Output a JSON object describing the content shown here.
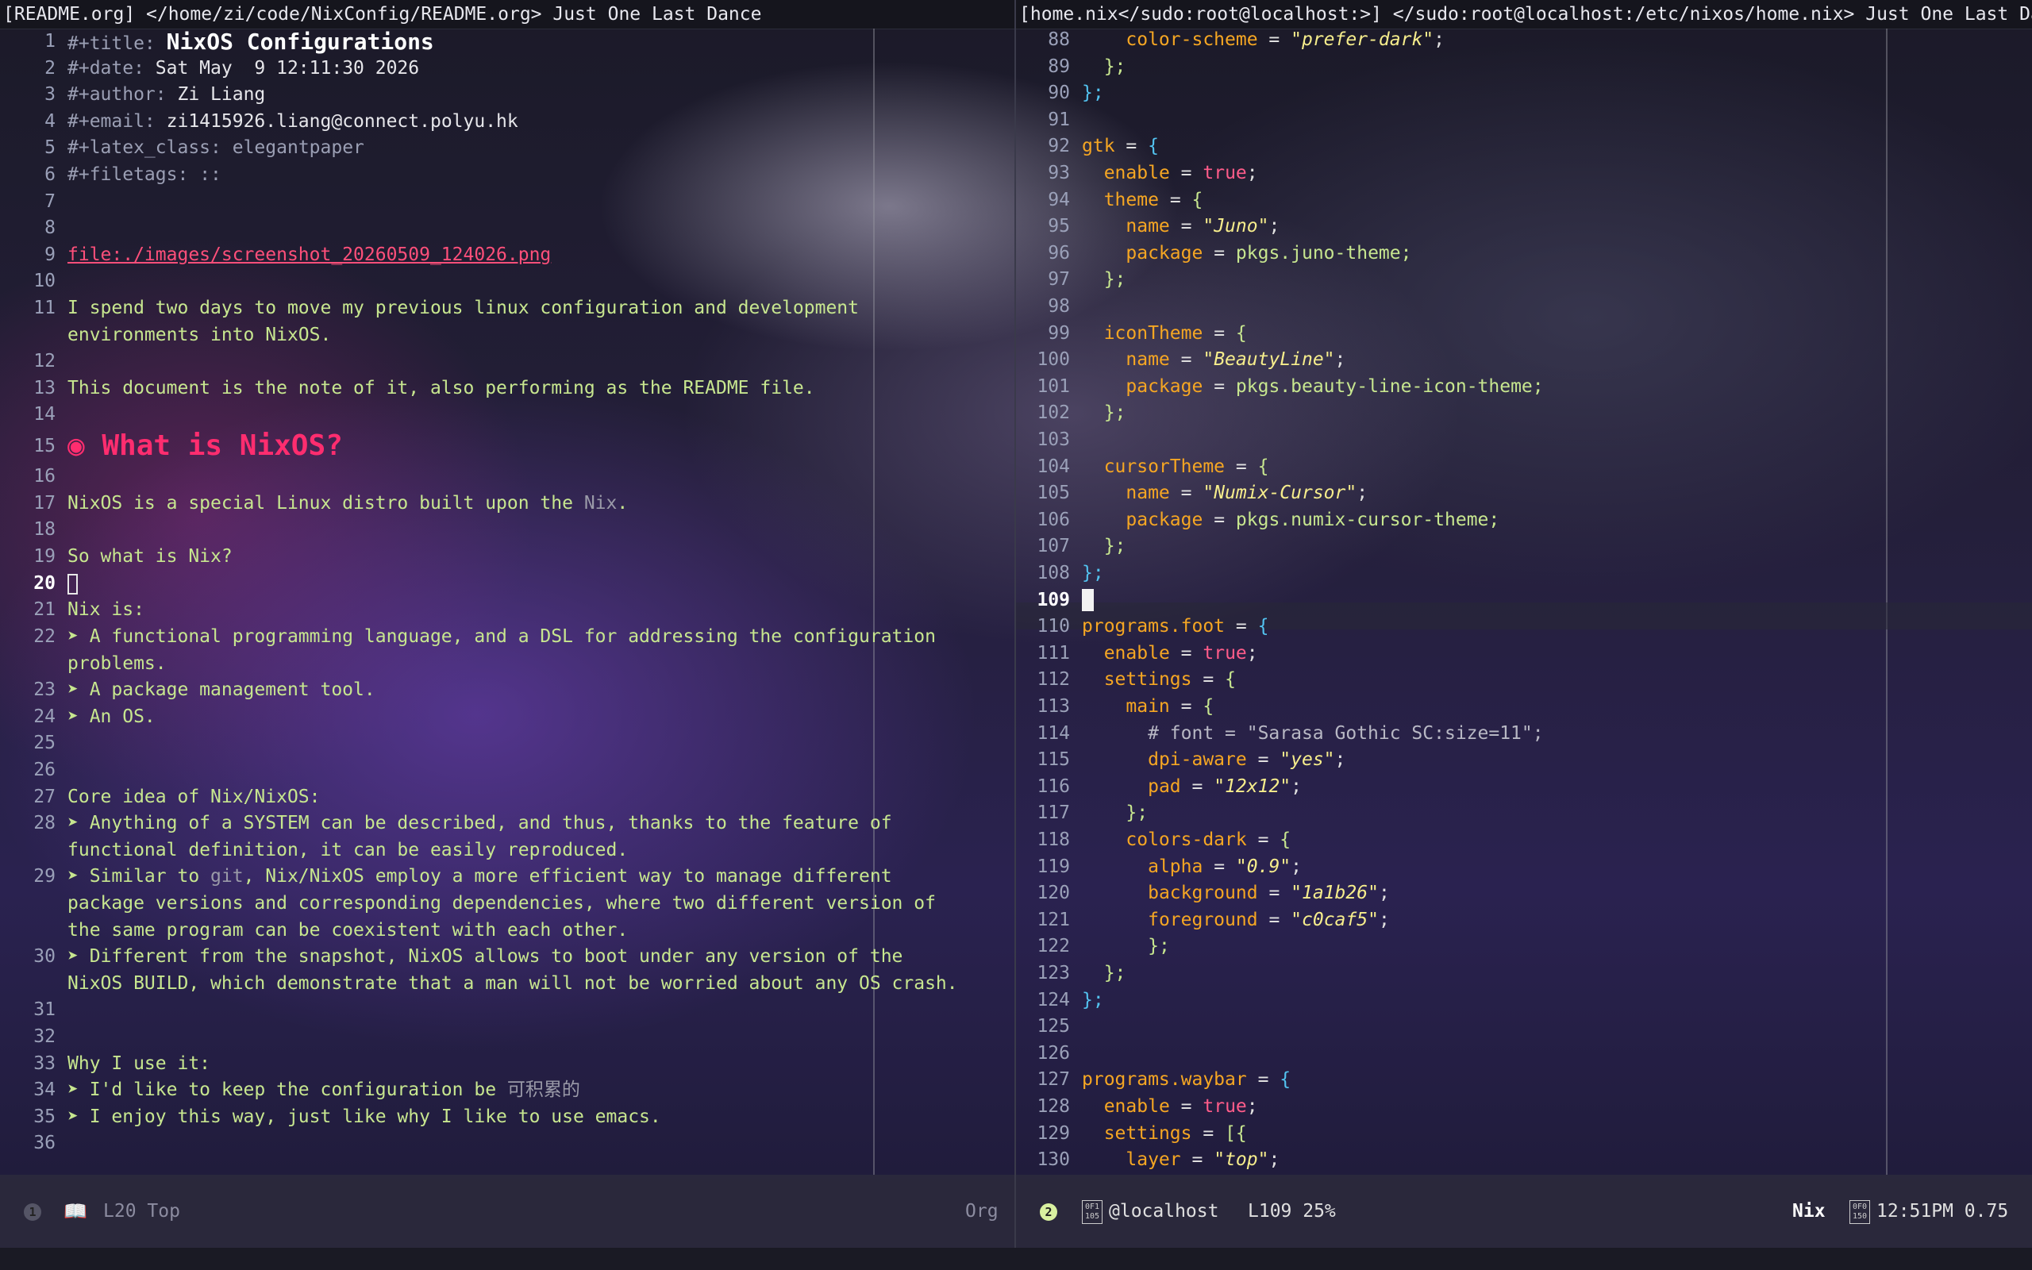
{
  "window": {
    "left_title": "[README.org] </home/zi/code/NixConfig/README.org> Just One Last Dance",
    "right_title": "[home.nix</sudo:root@localhost:>] </sudo:root@localhost:/etc/nixos/home.nix> Just One Last Dance"
  },
  "left_pane": {
    "filename": "README.org",
    "meta": {
      "title_key": "#+title:",
      "title_val": "NixOS Configurations",
      "date_key": "#+date:",
      "date_val": "Sat May  9 12:11:30 2026",
      "author_key": "#+author:",
      "author_val": "Zi Liang",
      "email_key": "#+email:",
      "email_val": "zi1415926.liang@connect.polyu.hk",
      "latex_key": "#+latex_class:",
      "latex_val": "elegantpaper",
      "filetags_key": "#+filetags:",
      "filetags_val": "::"
    },
    "link": "file:./images/screenshot_20260509_124026.png",
    "p11a": "I spend two days to move my previous linux configuration and development",
    "p11b": "environments into NixOS.",
    "p13": "This document is the note of it, also performing as the README file.",
    "h15_bullet": "◉",
    "h15": "What is NixOS?",
    "p17a": "NixOS is a special Linux distro built upon the ",
    "p17b": "Nix",
    "p17c": ".",
    "p19": "So what is Nix?",
    "p21": "Nix is:",
    "b22a": "➤ A functional programming language, and a DSL for addressing the configuration",
    "b22b": "problems.",
    "b23": "➤ A package management tool.",
    "b24": "➤ An OS.",
    "p27": "Core idea of Nix/NixOS:",
    "b28a": "➤ Anything of a SYSTEM can be described, and thus, thanks to the feature of",
    "b28b": "functional definition, it can be easily reproduced.",
    "b29a1": "➤ Similar to ",
    "b29a2": "git",
    "b29a3": ", Nix/NixOS employ a more efficient way to manage different",
    "b29b": "package versions and corresponding dependencies, where two different version of",
    "b29c": "the same program can be coexistent with each other.",
    "b30a": "➤ Different from the snapshot, NixOS allows to boot under any version of the",
    "b30b": "NixOS BUILD, which demonstrate that a man will not be worried about any OS crash.",
    "p33": "Why I use it:",
    "b34a": "➤ I'd like to keep the configuration be ",
    "b34b": "可积累的",
    "b35": "➤ I enjoy this way, just like why I like to use emacs.",
    "line_numbers": [
      "1",
      "2",
      "3",
      "4",
      "5",
      "6",
      "7",
      "8",
      "9",
      "10",
      "11",
      "12",
      "13",
      "14",
      "15",
      "16",
      "17",
      "18",
      "19",
      "20",
      "21",
      "22",
      "23",
      "24",
      "25",
      "26",
      "27",
      "28",
      "29",
      "30",
      "31",
      "32",
      "33",
      "34",
      "35",
      "36"
    ]
  },
  "right_pane": {
    "filename": "home.nix",
    "line_numbers": [
      "88",
      "89",
      "90",
      "91",
      "92",
      "93",
      "94",
      "95",
      "96",
      "97",
      "98",
      "99",
      "100",
      "101",
      "102",
      "103",
      "104",
      "105",
      "106",
      "107",
      "108",
      "109",
      "110",
      "111",
      "112",
      "113",
      "114",
      "115",
      "116",
      "117",
      "118",
      "119",
      "120",
      "121",
      "122",
      "123",
      "124",
      "125",
      "126",
      "127",
      "128",
      "129",
      "130"
    ],
    "code": {
      "l88k": "color-scheme",
      "l88v": "\"prefer-dark\"",
      "l89": "};",
      "l90": "};",
      "l92k": "gtk",
      "l92b": "{",
      "l93k": "enable",
      "l93v": "true",
      "l94k": "theme",
      "l94b": "{",
      "l95k": "name",
      "l95v": "\"Juno\"",
      "l96k": "package",
      "l96v": "pkgs.juno-theme;",
      "l97": "};",
      "l99k": "iconTheme",
      "l99b": "{",
      "l100k": "name",
      "l100v": "\"BeautyLine\"",
      "l101k": "package",
      "l101v": "pkgs.beauty-line-icon-theme;",
      "l102": "};",
      "l104k": "cursorTheme",
      "l104b": "{",
      "l105k": "name",
      "l105v": "\"Numix-Cursor\"",
      "l106k": "package",
      "l106v": "pkgs.numix-cursor-theme;",
      "l107": "};",
      "l108": "};",
      "l110k": "programs.foot",
      "l110b": "{",
      "l111k": "enable",
      "l111v": "true",
      "l112k": "settings",
      "l112b": "{",
      "l113k": "main",
      "l113b": "{",
      "l114": "# font = \"Sarasa Gothic SC:size=11\";",
      "l115k": "dpi-aware",
      "l115v": "\"yes\"",
      "l116k": "pad",
      "l116v": "\"12x12\"",
      "l117": "};",
      "l118k": "colors-dark",
      "l118b": "{",
      "l119k": "alpha",
      "l119v": "\"0.9\"",
      "l120k": "background",
      "l120v": "\"1a1b26\"",
      "l121k": "foreground",
      "l121v": "\"c0caf5\"",
      "l122": "};",
      "l123": "};",
      "l124": "};",
      "l127k": "programs.waybar",
      "l127b": "{",
      "l128k": "enable",
      "l128v": "true",
      "l129k": "settings",
      "l129b": "[{",
      "l130k": "layer",
      "l130v": "\"top\""
    }
  },
  "modeline_left": {
    "badge": "1",
    "position": "L20 Top",
    "mode": "Org"
  },
  "modeline_right": {
    "badge": "2",
    "host": "@localhost",
    "position": "L109 25%",
    "mode": "Nix",
    "box_top": "0F1",
    "box_bottom": "105",
    "box2_top": "0F0",
    "box2_bottom": "150",
    "time_load": "12:51PM 0.75"
  }
}
